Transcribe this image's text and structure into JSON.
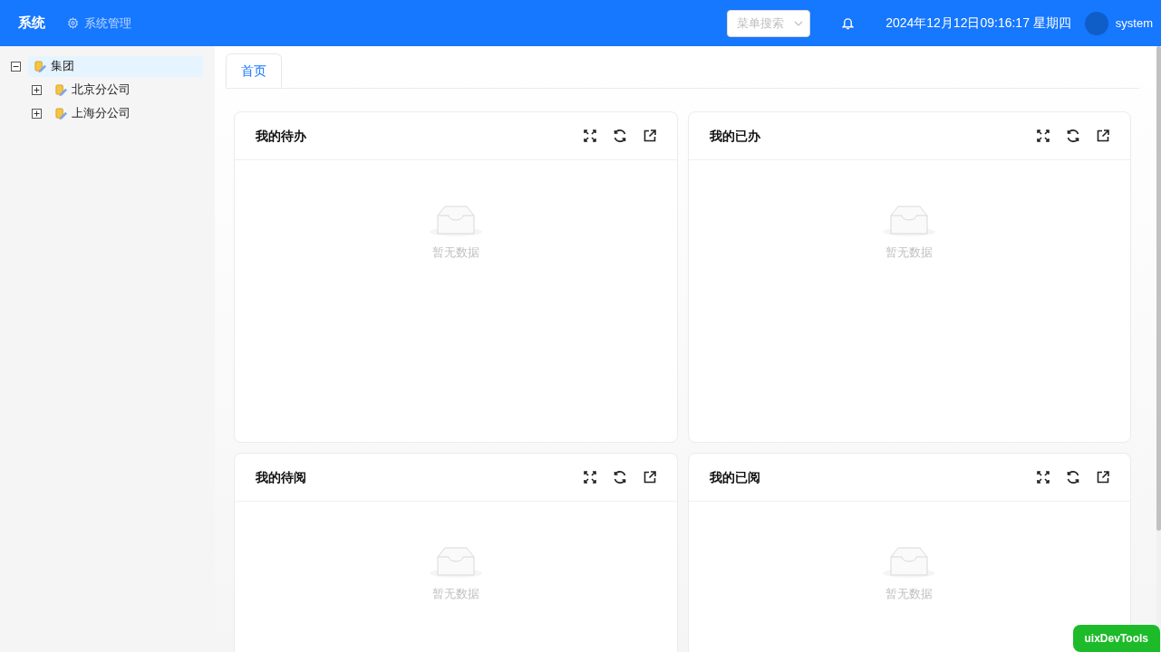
{
  "header": {
    "title": "系统",
    "module": "系统管理",
    "search": {
      "placeholder": "菜单搜索"
    },
    "datetime": "2024年12月12日09:16:17 星期四",
    "user": "system"
  },
  "tree": [
    {
      "label": "集团",
      "expanded": true,
      "selected": true,
      "children": [
        {
          "label": "北京分公司",
          "expanded": false,
          "selected": false
        },
        {
          "label": "上海分公司",
          "expanded": false,
          "selected": false
        }
      ]
    }
  ],
  "tabs": [
    {
      "label": "首页",
      "selected": true
    }
  ],
  "cards": [
    {
      "title": "我的待办",
      "empty_text": "暂无数据"
    },
    {
      "title": "我的已办",
      "empty_text": "暂无数据"
    },
    {
      "title": "我的待阅",
      "empty_text": "暂无数据"
    },
    {
      "title": "我的已阅",
      "empty_text": "暂无数据"
    }
  ],
  "devtools_badge": "uixDevTools"
}
